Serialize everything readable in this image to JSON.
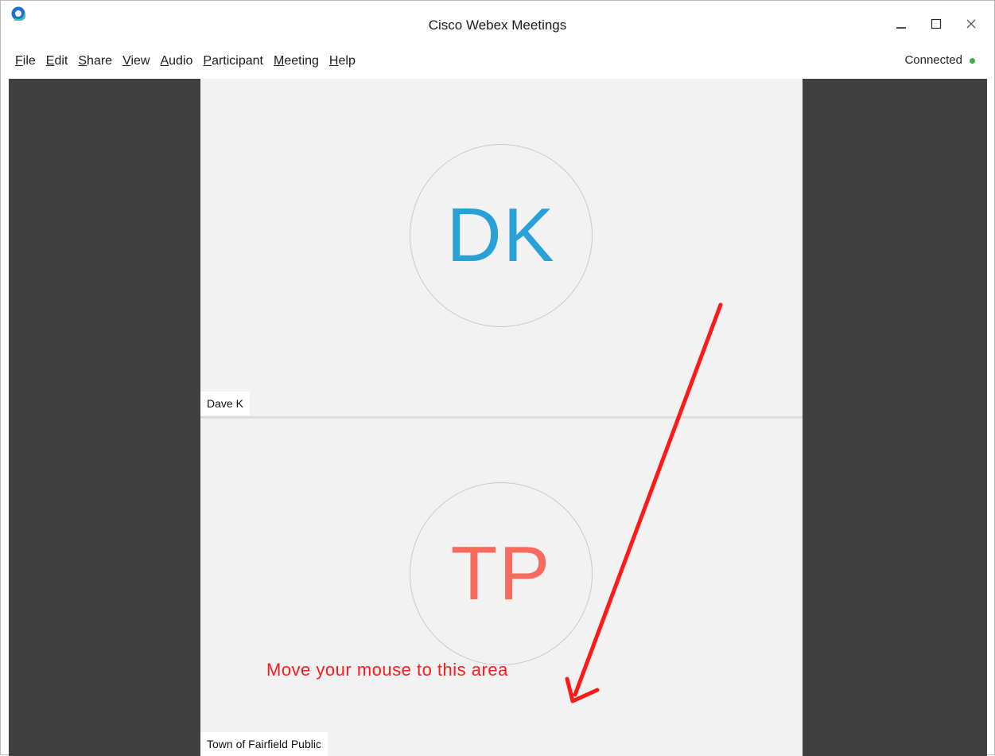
{
  "window": {
    "title": "Cisco Webex Meetings",
    "icons": {
      "app": "webex-logo-icon",
      "minimize": "minimize-icon",
      "maximize": "maximize-icon",
      "close": "close-icon"
    }
  },
  "menu": {
    "items": [
      {
        "mnemonic": "F",
        "rest": "ile"
      },
      {
        "mnemonic": "E",
        "rest": "dit"
      },
      {
        "mnemonic": "S",
        "rest": "hare"
      },
      {
        "mnemonic": "V",
        "rest": "iew"
      },
      {
        "mnemonic": "A",
        "rest": "udio"
      },
      {
        "mnemonic": "P",
        "rest": "articipant"
      },
      {
        "mnemonic": "M",
        "rest": "eeting"
      },
      {
        "mnemonic": "H",
        "rest": "elp"
      }
    ]
  },
  "status": {
    "label": "Connected",
    "color": "#3fae49"
  },
  "participants": [
    {
      "initials": "DK",
      "name": "Dave K",
      "color": "#2aa0d8"
    },
    {
      "initials": "TP",
      "name": "Town of Fairfield Public",
      "color": "#f76a5e"
    }
  ],
  "annotation": {
    "text": "Move your mouse to this area",
    "color": "#ff1a1a"
  },
  "colors": {
    "stage_background": "#404040",
    "tile_background": "#f2f2f2"
  }
}
